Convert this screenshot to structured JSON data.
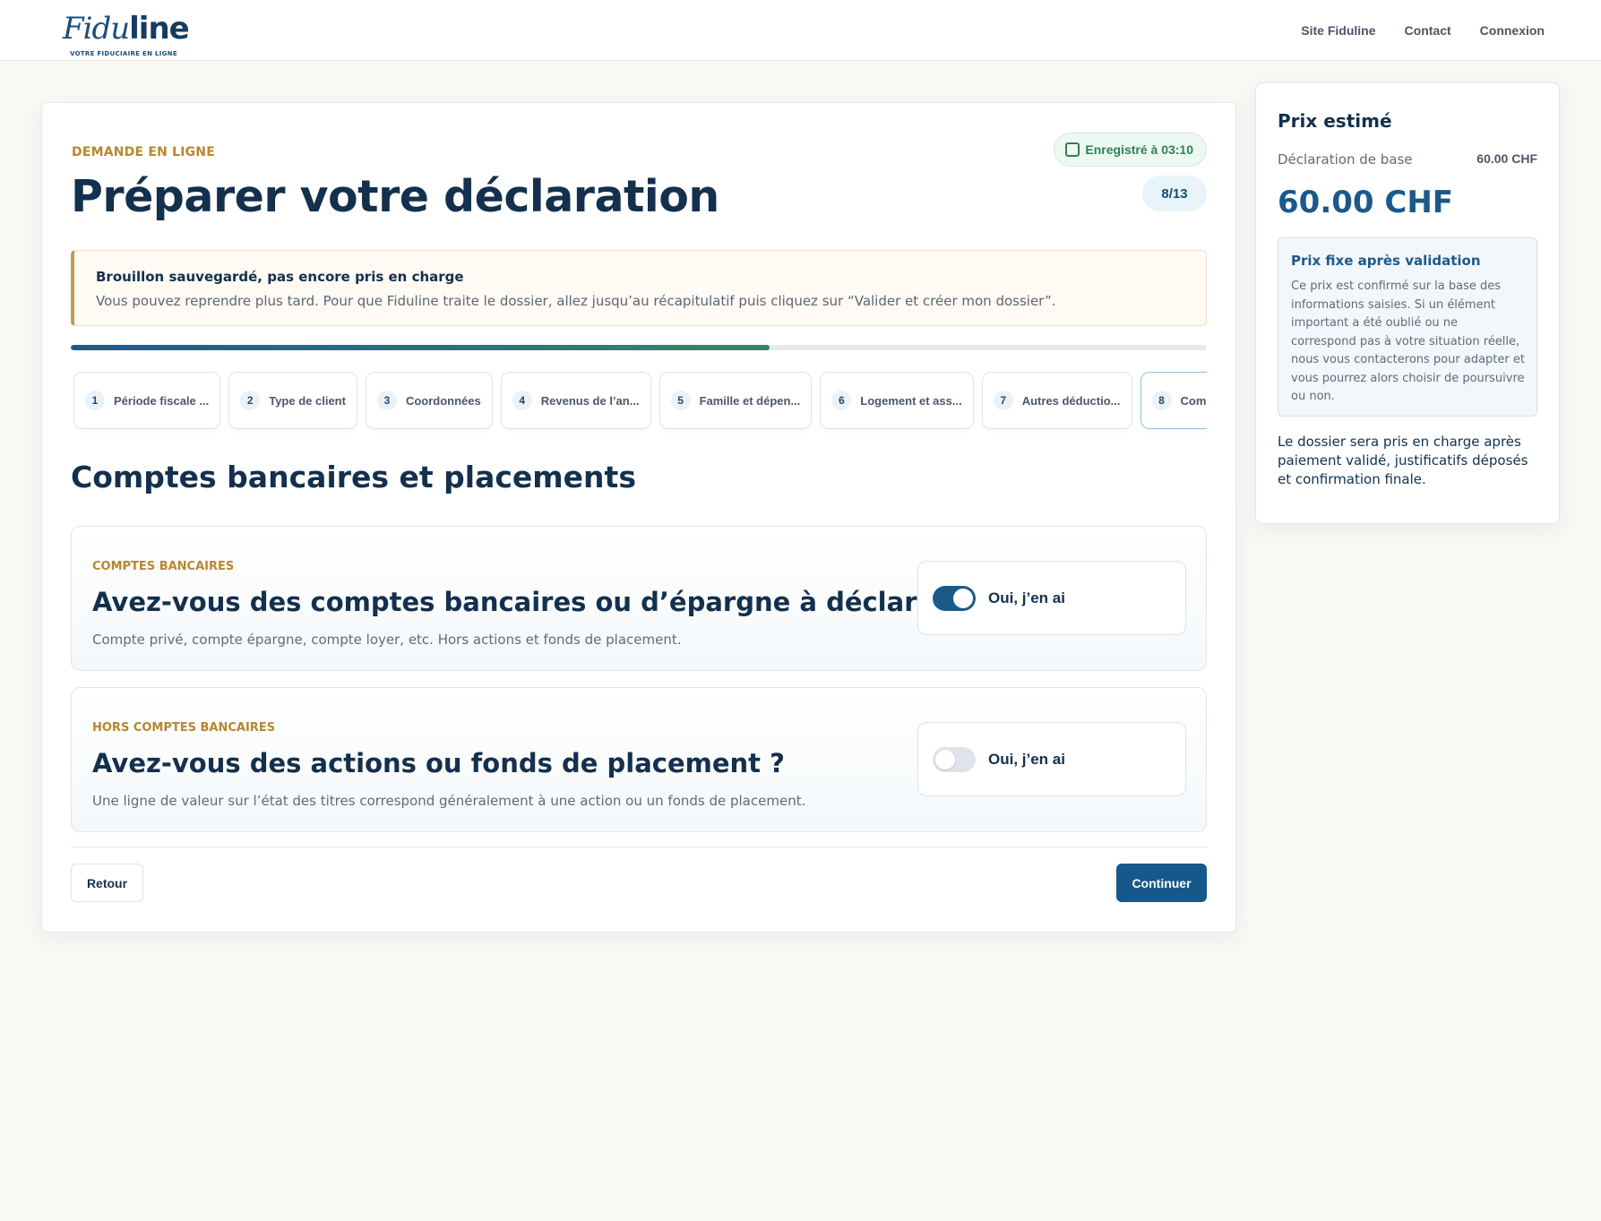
{
  "header": {
    "logo_script": "Fidu",
    "logo_bold": "line",
    "logo_tagline": "VOTRE FIDUCIAIRE EN LIGNE",
    "nav": [
      "Site Fiduline",
      "Contact",
      "Connexion"
    ]
  },
  "form": {
    "eyebrow": "DEMANDE EN LIGNE",
    "title": "Préparer votre déclaration",
    "saved_status": "Enregistré à 03:10",
    "step_counter": "8/13",
    "notice": {
      "title": "Brouillon sauvegardé, pas encore pris en charge",
      "text": "Vous pouvez reprendre plus tard. Pour que Fiduline traite le dossier, allez jusqu’au récapitulatif puis cliquez sur “Valider et créer mon dossier”."
    },
    "progress_fraction": 0.615,
    "steps": [
      {
        "num": "1",
        "label": "Période fiscale ..."
      },
      {
        "num": "2",
        "label": "Type de client"
      },
      {
        "num": "3",
        "label": "Coordonnées"
      },
      {
        "num": "4",
        "label": "Revenus de l’an..."
      },
      {
        "num": "5",
        "label": "Famille et dépen..."
      },
      {
        "num": "6",
        "label": "Logement et ass..."
      },
      {
        "num": "7",
        "label": "Autres déductio..."
      },
      {
        "num": "8",
        "label": "Comptes bancaires"
      }
    ],
    "section_title": "Comptes bancaires et placements",
    "questions": [
      {
        "eyebrow": "COMPTES BANCAIRES",
        "title": "Avez-vous des comptes bancaires ou d’épargne à déclarer ?",
        "help": "Compte privé, compte épargne, compte loyer, etc. Hors actions et fonds de placement.",
        "toggle_label": "Oui, j’en ai",
        "checked": true
      },
      {
        "eyebrow": "HORS COMPTES BANCAIRES",
        "title": "Avez-vous des actions ou fonds de placement ?",
        "help": "Une ligne de valeur sur l’état des titres correspond généralement à une action ou un fonds de placement.",
        "toggle_label": "Oui, j’en ai",
        "checked": false
      }
    ],
    "back_label": "Retour",
    "continue_label": "Continuer"
  },
  "price": {
    "title": "Prix estimé",
    "base_label": "Déclaration de base",
    "base_value": "60.00 CHF",
    "total": "60.00 CHF",
    "fixed_title": "Prix fixe après validation",
    "fixed_text": "Ce prix est confirmé sur la base des informations saisies. Si un élément important a été oublié ou ne correspond pas à votre situation réelle, nous vous contacterons pour adapter et vous pourrez alors choisir de poursuivre ou non.",
    "note": "Le dossier sera pris en charge après paiement validé, justificatifs déposés et confirmation finale."
  },
  "colors": {
    "accent": "#17588a",
    "gold": "#b8862e",
    "success": "#2f7f5c",
    "text": "#13304d"
  }
}
